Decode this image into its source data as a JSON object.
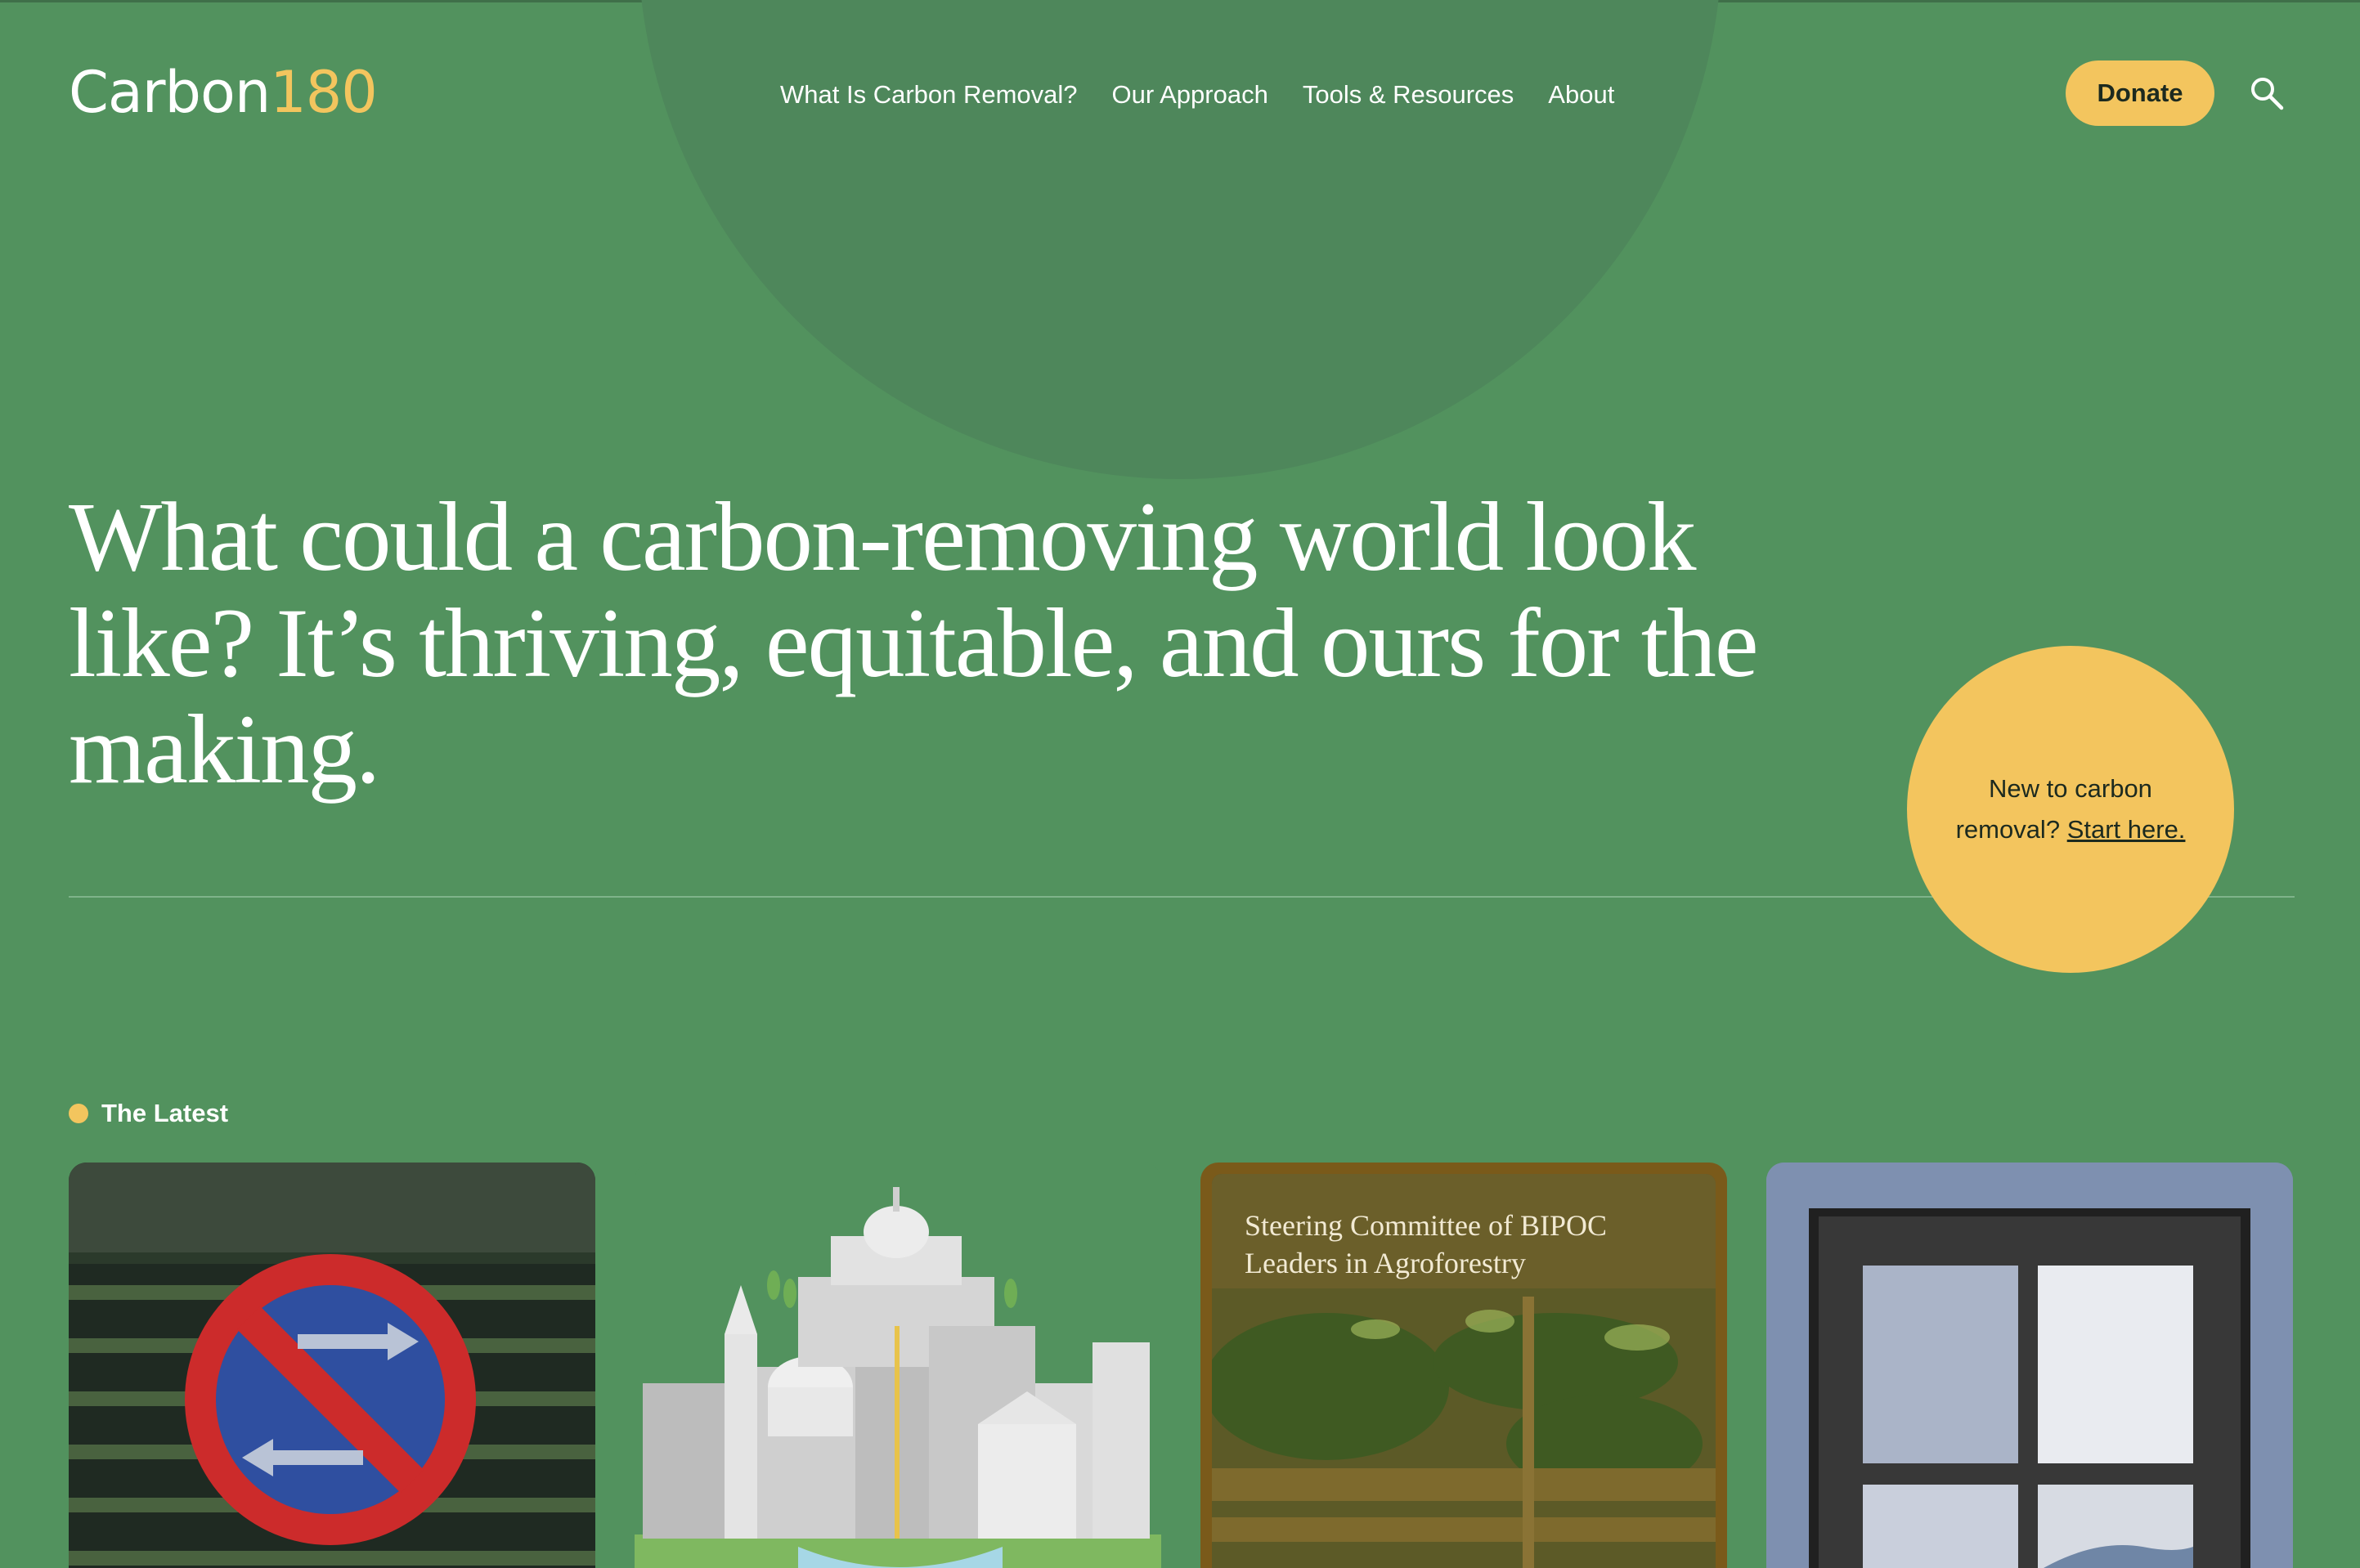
{
  "header": {
    "logo": {
      "word": "Carbon",
      "number": "180"
    },
    "nav": [
      {
        "label": "What Is Carbon Removal?"
      },
      {
        "label": "Our Approach"
      },
      {
        "label": "Tools & Resources"
      },
      {
        "label": "About"
      }
    ],
    "donate_label": "Donate",
    "search_icon": "search-icon"
  },
  "hero": {
    "headline": "What could a carbon-removing world look like? It’s thriving, equitable, and ours for the making.",
    "cta": {
      "text": "New to carbon removal?",
      "link_label": "Start here."
    }
  },
  "latest": {
    "label": "The Latest",
    "cards": [
      {
        "image": "no-parking-sign-image"
      },
      {
        "image": "capitol-city-illustration"
      },
      {
        "image": "agroforestry-aerial-image",
        "caption": "Steering Committee of BIPOC Leaders in Agroforestry"
      },
      {
        "image": "window-image"
      }
    ]
  },
  "colors": {
    "background": "#52925e",
    "accent": "#f3c55e",
    "text": "#ffffff"
  }
}
